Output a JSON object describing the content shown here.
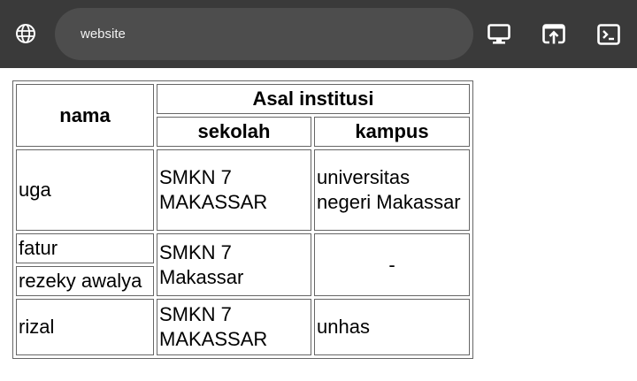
{
  "toolbar": {
    "url_text": "website",
    "background": "#3a3a3a",
    "url_bar_color": "#4d4d4d",
    "icons": [
      "globe-icon",
      "desktop-icon",
      "open-in-new-icon",
      "terminal-icon"
    ]
  },
  "table": {
    "header": {
      "nama": "nama",
      "asal": "Asal institusi",
      "sekolah": "sekolah",
      "kampus": "kampus"
    },
    "rows": [
      {
        "nama": "uga",
        "sekolah": "SMKN 7 MAKASSAR",
        "kampus": "universitas negeri Makassar"
      },
      {
        "nama": "fatur"
      },
      {
        "nama": "rezeky awalya"
      },
      {
        "nama": "rizal",
        "sekolah": "SMKN 7 MAKASSAR",
        "kampus": "unhas"
      }
    ],
    "shared": {
      "sekolah": "SMKN 7 Makassar",
      "kampus": "-"
    }
  }
}
